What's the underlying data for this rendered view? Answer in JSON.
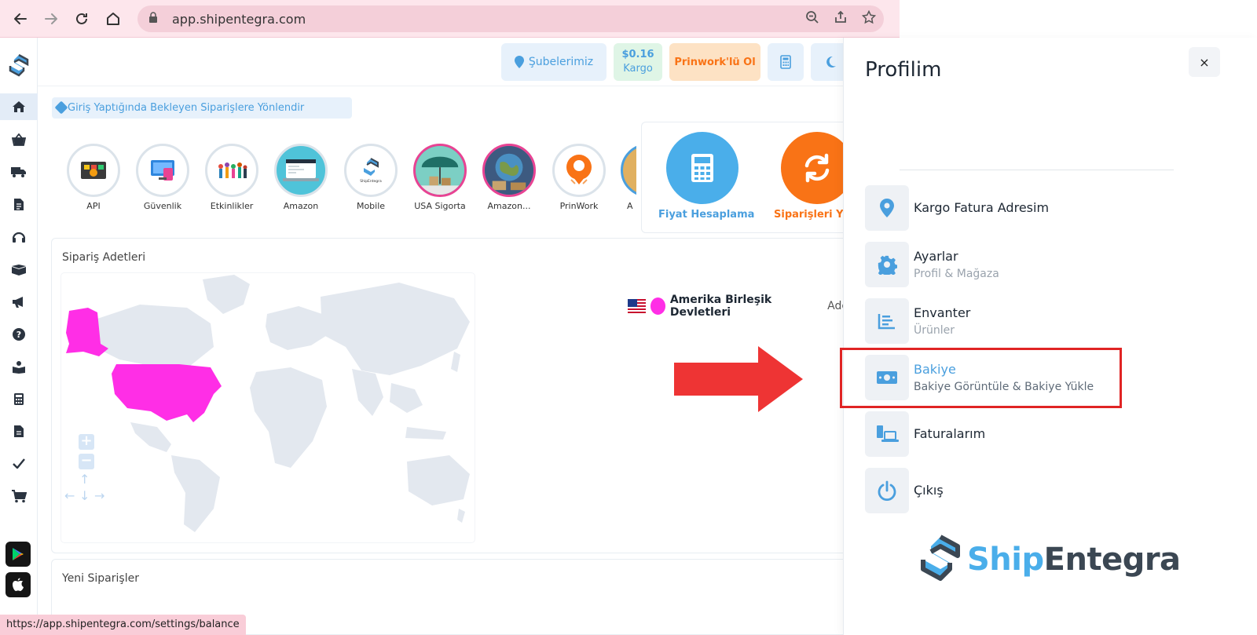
{
  "browser": {
    "url": "app.shipentegra.com",
    "status_url": "https://app.shipentegra.com/settings/balance"
  },
  "topbar": {
    "branches_label": "Şubelerimiz",
    "price_value": "$0.16",
    "price_unit": "Kargo",
    "prinwork_label": "Prinwork'lü Ol"
  },
  "banner": {
    "text": "Giriş Yaptığında Bekleyen Siparişlere Yönlendir"
  },
  "stories": [
    {
      "label": "API"
    },
    {
      "label": "Güvenlik"
    },
    {
      "label": "Etkinlikler"
    },
    {
      "label": "Amazon"
    },
    {
      "label": "Mobile"
    },
    {
      "label": "USA Sigorta"
    },
    {
      "label": "Amazon..."
    },
    {
      "label": "PrinWork"
    },
    {
      "label": "A"
    }
  ],
  "quick_actions": {
    "price_calc": "Fiyat Hesaplama",
    "orders_refresh": "Siparişleri Yer"
  },
  "map_card": {
    "title": "Sipariş Adetleri",
    "country": "Amerika Birleşik Devletleri",
    "count_label": "Ade"
  },
  "new_orders": {
    "title": "Yeni Siparişler"
  },
  "profile": {
    "title": "Profilim",
    "close": "×",
    "brand_part1": "Ship",
    "brand_part2": "Entegra",
    "menu": [
      {
        "title": "Kargo Fatura Adresim",
        "subtitle": ""
      },
      {
        "title": "Ayarlar",
        "subtitle": "Profil & Mağaza"
      },
      {
        "title": "Envanter",
        "subtitle": "Ürünler"
      },
      {
        "title": "Bakiye",
        "subtitle": "Bakiye Görüntüle & Bakiye Yükle"
      },
      {
        "title": "Faturalarım",
        "subtitle": ""
      },
      {
        "title": "Çıkış",
        "subtitle": ""
      }
    ]
  },
  "colors": {
    "accent": "#4a9fde",
    "highlight": "#e02424",
    "map_highlight": "#ff2ee6",
    "orange": "#f97316"
  }
}
